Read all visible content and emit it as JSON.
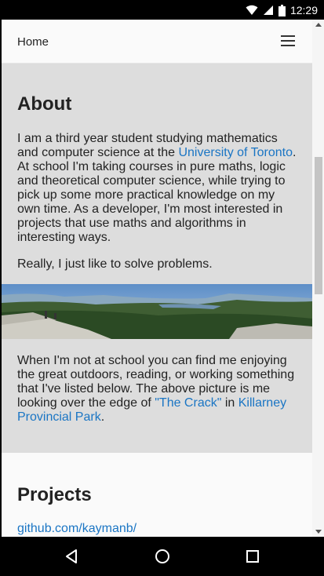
{
  "status_bar": {
    "time": "12:29",
    "icons": [
      "wifi-icon",
      "cell-signal-icon",
      "battery-icon"
    ]
  },
  "nav": {
    "home_label": "Home",
    "menu_icon": "hamburger-menu-icon"
  },
  "about": {
    "heading": "About",
    "p1_a": "I am a third year student studying mathematics and computer science at the ",
    "p1_link": "University of Toronto",
    "p1_b": ". At school I'm taking courses in pure maths, logic and theoretical computer science, while trying to pick up some more practical knowledge on my own time. As a developer, I'm most interested in projects that use maths and algorithms in interesting ways.",
    "p2": "Really, I just like to solve problems.",
    "p3_a": "When I'm not at school you can find me enjoying the great outdoors, reading, or working something that I've listed below. The above picture is me looking over the edge of ",
    "p3_link1": "\"The Crack\"",
    "p3_b": " in ",
    "p3_link2": "Killarney Provincial Park",
    "p3_c": "."
  },
  "projects": {
    "heading": "Projects",
    "github_link": "github.com/kaymanb/"
  },
  "android_nav": {
    "back": "back-icon",
    "home": "home-circle-icon",
    "recents": "recents-square-icon"
  },
  "colors": {
    "link": "#1a75c4",
    "about_bg": "#dddddd",
    "page_bg": "#fafafa"
  }
}
